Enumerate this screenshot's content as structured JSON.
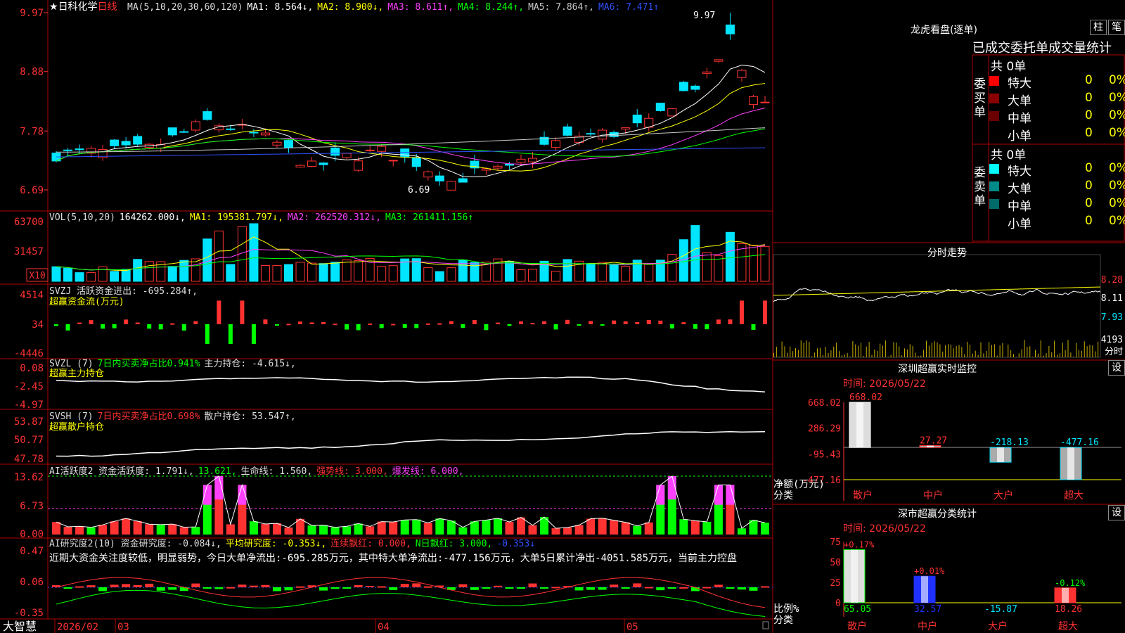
{
  "colors": {
    "up": "#ff3232",
    "down": "#00e5ff",
    "frame": "#b00000",
    "ma1": "#ffffff",
    "ma2": "#ffff00",
    "ma3": "#ff40ff",
    "ma4": "#00ff00",
    "ma5": "#c8c8c8",
    "ma6": "#3050ff",
    "green": "#00ff00",
    "yellow": "#ffff00",
    "magenta": "#ff40ff"
  },
  "stock": {
    "star": "★",
    "name": "日科化学",
    "period": "日线"
  },
  "main_legend": [
    {
      "t": "MA(5,10,20,30,60,120)",
      "c": "#dddddd"
    },
    {
      "t": "MA1: 8.564↓,",
      "c": "#ffffff"
    },
    {
      "t": "MA2: 8.900↓,",
      "c": "#ffff00"
    },
    {
      "t": "MA3: 8.611↑,",
      "c": "#ff40ff"
    },
    {
      "t": "MA4: 8.244↑,",
      "c": "#00ff00"
    },
    {
      "t": "MA5: 7.864↑,",
      "c": "#c8c8c8"
    },
    {
      "t": "MA6: 7.471↑",
      "c": "#3050ff"
    }
  ],
  "main_axis": [
    "9.97",
    "8.88",
    "7.78",
    "6.69"
  ],
  "hi_label": "9.97",
  "lo_label": "6.69",
  "vol_legend": [
    {
      "t": "VOL(5,10,20)",
      "c": "#dddddd"
    },
    {
      "t": "164262.000↓,",
      "c": "#ffffff"
    },
    {
      "t": "MA1: 195381.797↓,",
      "c": "#ffff00"
    },
    {
      "t": "MA2: 262520.312↓,",
      "c": "#ff40ff"
    },
    {
      "t": "MA3: 261411.156↑",
      "c": "#00ff00"
    }
  ],
  "vol_axis": [
    "63700",
    "31457"
  ],
  "vol_unit": "X10",
  "svzj": {
    "legend": [
      {
        "t": "SVZJ  活跃资金进出: -695.284↑,",
        "c": "#dddddd"
      }
    ],
    "sub": "超赢资金流(万元)",
    "axis": [
      "4514",
      "34",
      "-4446"
    ]
  },
  "svzl": {
    "legend": [
      {
        "t": "SVZL (7)",
        "c": "#dddddd"
      },
      {
        "t": "7日内买卖净占比0.941%",
        "c": "#00ff00"
      },
      {
        "t": "主力持仓: -4.615↓,",
        "c": "#dddddd"
      }
    ],
    "sub": "超赢主力持仓",
    "axis": [
      "0.08",
      "-2.45",
      "-4.97"
    ]
  },
  "svsh": {
    "legend": [
      {
        "t": "SVSH (7)",
        "c": "#dddddd"
      },
      {
        "t": "7日内买卖净占比0.698%",
        "c": "#ff3232"
      },
      {
        "t": "散户持仓: 53.547↑,",
        "c": "#dddddd"
      }
    ],
    "sub": "超赢散户持仓",
    "axis": [
      "53.87",
      "50.77",
      "47.78"
    ]
  },
  "ai1": {
    "legend": [
      {
        "t": "AI活跃度2 资金活跃度: 1.791↓,",
        "c": "#dddddd"
      },
      {
        "t": "13.621,",
        "c": "#00ff00"
      },
      {
        "t": "生命线: 1.560,",
        "c": "#dddddd"
      },
      {
        "t": "强势线: 3.000,",
        "c": "#ff3232"
      },
      {
        "t": "爆发线: 6.000,",
        "c": "#ff40ff"
      }
    ],
    "axis": [
      "13.62",
      "6.73",
      "0.00"
    ]
  },
  "ai2": {
    "legend": [
      {
        "t": "AI研究度2(10) 资金研究度: -0.084↓,",
        "c": "#dddddd"
      },
      {
        "t": "平均研究度: -0.353↓,",
        "c": "#ffff00"
      },
      {
        "t": "连续飘红: 0.000,",
        "c": "#ff3232"
      },
      {
        "t": "N日飘红: 3.000,",
        "c": "#00ff00"
      },
      {
        "t": "-0.353↓",
        "c": "#3050ff"
      }
    ],
    "note": "近期大资金关注度较低，明显弱势，今日大单净流出:-695.285万元，其中特大单净流出:-477.156万元，大单5日累计净出-4051.585万元，当前主力控盘",
    "axis": [
      "0.47",
      "0.06",
      "-0.35"
    ]
  },
  "bottom": {
    "brand": "大智慧",
    "d0": "2026/02",
    "d1": "03",
    "d2": "04",
    "d3": "05"
  },
  "panel1": {
    "title": "龙虎看盘(逐单)",
    "btn1": "柱",
    "btn2": "笔",
    "cols": [
      "已成交",
      "委托单",
      "成交量统计"
    ],
    "buy_label": "委买单",
    "sell_label": "委卖单",
    "buy": {
      "total": "共 0单",
      "rows": [
        {
          "name": "特大",
          "v": "0",
          "p": "0%",
          "c": "#ff0000"
        },
        {
          "name": "大单",
          "v": "0",
          "p": "0%",
          "c": "#8b0000"
        },
        {
          "name": "中单",
          "v": "0",
          "p": "0%",
          "c": "#6a0000"
        },
        {
          "name": "小单",
          "v": "0",
          "p": "0%",
          "c": "#000000"
        }
      ]
    },
    "sell": {
      "total": "共 0单",
      "rows": [
        {
          "name": "特大",
          "v": "0",
          "p": "0%",
          "c": "#00ffff"
        },
        {
          "name": "大单",
          "v": "0",
          "p": "0%",
          "c": "#008b8b"
        },
        {
          "name": "中单",
          "v": "0",
          "p": "0%",
          "c": "#006a6a"
        },
        {
          "name": "小单",
          "v": "0",
          "p": "0%",
          "c": "#000000"
        }
      ]
    }
  },
  "panel2": {
    "title": "分时走势",
    "axis": [
      "8.28",
      "8.11",
      "7.93",
      "4193"
    ],
    "unit": "分时"
  },
  "panel3": {
    "title": "深圳超赢实时监控",
    "btn": "设",
    "time": "时间: 2026/05/22",
    "ylabel1": "净额(万元)",
    "ylabel2": "分类",
    "axis": [
      "668.02",
      "286.29",
      "-95.43",
      "-477.16"
    ],
    "bars": [
      {
        "label": "散户",
        "v": "668.02"
      },
      {
        "label": "中户",
        "v": "27.27"
      },
      {
        "label": "大户",
        "v": "-218.13"
      },
      {
        "label": "超大",
        "v": "-477.16"
      }
    ]
  },
  "panel4": {
    "title": "深市超赢分类统计",
    "btn": "设",
    "time": "时间: 2026/05/22",
    "ylabel1": "比例%",
    "ylabel2": "分类",
    "axis": [
      "75",
      "50",
      "25",
      "0"
    ],
    "bars": [
      {
        "label": "散户",
        "v": "65.05",
        "chg": "+0.17%"
      },
      {
        "label": "中户",
        "v": "32.57",
        "chg": "+0.01%"
      },
      {
        "label": "大户",
        "v": "-15.87",
        "chg": ""
      },
      {
        "label": "超大",
        "v": "18.26",
        "chg": "-0.12%"
      }
    ]
  },
  "chart_data": {
    "type": "bar",
    "title": "深圳超赢实时监控",
    "categories": [
      "散户",
      "中户",
      "大户",
      "超大"
    ],
    "values": [
      668.02,
      27.27,
      -218.13,
      -477.16
    ],
    "ylim": [
      -477.16,
      668.02
    ],
    "ylabel": "净额(万元)",
    "xlabel": "分类"
  }
}
